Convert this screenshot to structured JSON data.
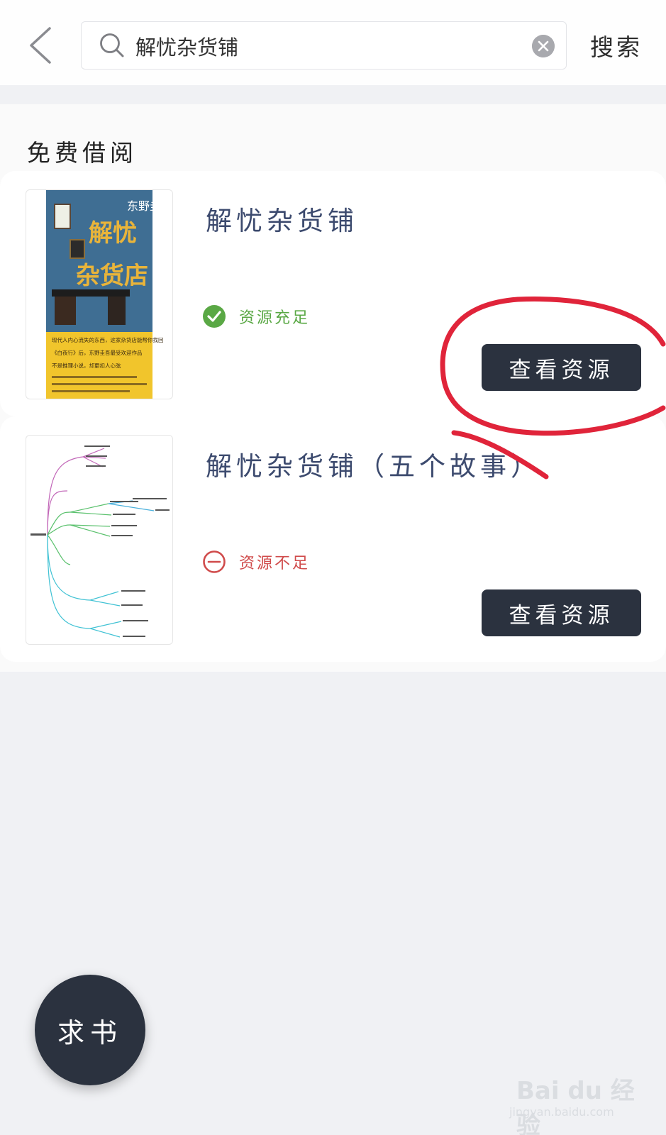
{
  "search": {
    "query": "解忧杂货铺",
    "button_label": "搜索"
  },
  "section": {
    "title": "免费借阅"
  },
  "results": [
    {
      "title": "解忧杂货铺",
      "status": "资源充足",
      "status_type": "sufficient",
      "button_label": "查看资源",
      "cover_text": {
        "title": "解忧\n杂货店",
        "author": "东野圭吾",
        "tagline_1": "现代人内心流失的东西，这家杂货店能帮你找回",
        "tagline_2": "《白夜行》后，东野圭吾最受欢迎作品",
        "tagline_3": "不是推理小说，却更扣人心弦"
      }
    },
    {
      "title": "解忧杂货铺（五个故事）",
      "status": "资源不足",
      "status_type": "insufficient",
      "button_label": "查看资源"
    }
  ],
  "fab": {
    "label": "求书"
  },
  "watermark": {
    "main": "Bai du 经验",
    "sub": "jingyan.baidu.com"
  },
  "colors": {
    "dark_button": "#2b323f",
    "title_blue": "#3c4a6e",
    "ok_green": "#5aa845",
    "bad_red": "#d04b4b",
    "annotation_red": "#e0243a"
  }
}
